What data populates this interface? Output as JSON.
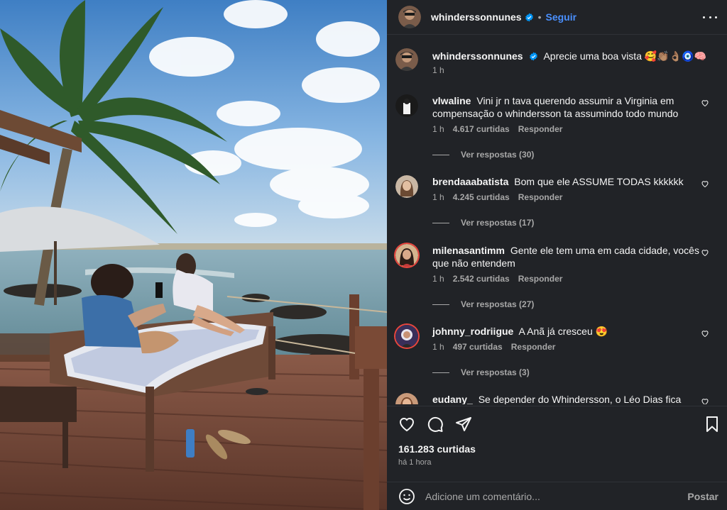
{
  "post": {
    "username": "whinderssonnunes",
    "follow_label": "Seguir",
    "dot": "•"
  },
  "caption": {
    "username": "whinderssonnunes",
    "text": "Aprecie uma boa vista 🥰👏🏽👌🏽🧿🧠",
    "time": "1 h"
  },
  "comments": [
    {
      "username": "vlwaline",
      "text": "Vini jr n tava querendo assumir a Virginia em compensação o whindersson ta assumindo todo mundo",
      "time": "1 h",
      "likes": "4.617 curtidas",
      "reply_label": "Responder",
      "view_replies": "Ver respostas (30)"
    },
    {
      "username": "brendaaabatista",
      "text": "Bom que ele ASSUME TODAS kkkkkk",
      "time": "1 h",
      "likes": "4.245 curtidas",
      "reply_label": "Responder",
      "view_replies": "Ver respostas (17)"
    },
    {
      "username": "milenasantimm",
      "text": "Gente ele tem uma em cada cidade, vocês que não entendem",
      "time": "1 h",
      "likes": "2.542 curtidas",
      "reply_label": "Responder",
      "view_replies": "Ver respostas (27)"
    },
    {
      "username": "johnny_rodriigue",
      "text": "A Anã já cresceu 😍",
      "time": "1 h",
      "likes": "497 curtidas",
      "reply_label": "Responder",
      "view_replies": "Ver respostas (3)"
    },
    {
      "username": "eudany_",
      "text": "Se depender do Whindersson, o Léo Dias fica",
      "time": "",
      "likes": "",
      "reply_label": "",
      "view_replies": ""
    }
  ],
  "actions": {
    "likes": "161.283 curtidas",
    "time_ago": "há 1 hora"
  },
  "add_comment": {
    "placeholder": "Adicione um comentário...",
    "post_label": "Postar"
  },
  "icons": [
    "verified-badge-icon",
    "more-options-icon",
    "heart-icon",
    "comment-icon",
    "share-icon",
    "bookmark-icon",
    "emoji-icon"
  ],
  "colors": {
    "panel_bg": "#212327",
    "accent_blue": "#4a90ff",
    "text_secondary": "#a8a8a8"
  }
}
